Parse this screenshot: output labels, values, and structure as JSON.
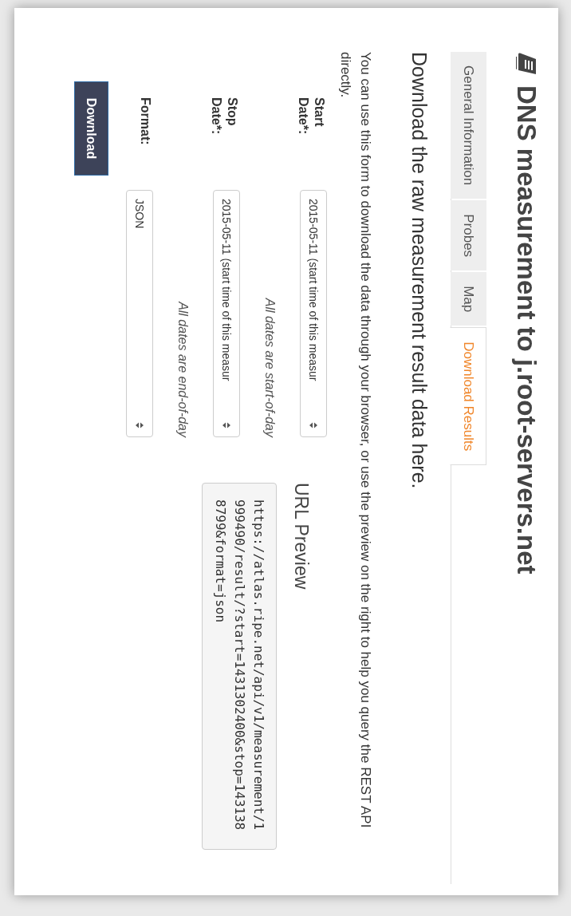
{
  "page": {
    "title": "DNS measurement to j.root-servers.net"
  },
  "tabs": [
    {
      "label": "General Information",
      "selected": false
    },
    {
      "label": "Probes",
      "selected": false
    },
    {
      "label": "Map",
      "selected": false
    },
    {
      "label": "Download Results",
      "selected": true
    }
  ],
  "heading": "Download the raw measurement result data here.",
  "intro": "You can use this form to download the data through your browser, or use the preview on the right to help you query the REST API directly.",
  "form": {
    "fields": [
      {
        "label": "Start Date*:",
        "value": "2015-05-11 (start time of this measur",
        "hint": "All dates are start-of-day"
      },
      {
        "label": "Stop Date*:",
        "value": "2015-05-11 (start time of this measur",
        "hint": "All dates are end-of-day"
      },
      {
        "label": "Format:",
        "value": "JSON"
      }
    ],
    "button": "Download"
  },
  "url_preview": {
    "title": "URL Preview",
    "url": "https://atlas.ripe.net/api/v1/measurement/1999490/result/?start=1431302400&stop=1431388799&format=json"
  }
}
